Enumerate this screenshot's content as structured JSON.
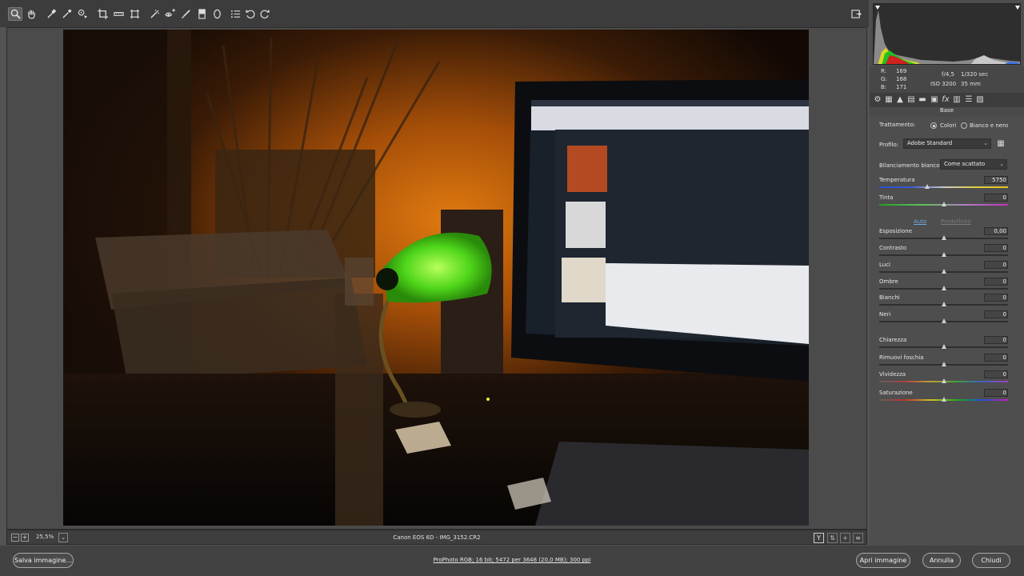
{
  "colors": {
    "accent_blue": "#6fa8dc",
    "panel": "#4e4e4e",
    "toolbar": "#3c3c3c"
  },
  "toolbar": {
    "tools": [
      "zoom-icon",
      "hand-icon",
      "white-balance-icon",
      "color-sampler-icon",
      "target-adjust-icon",
      "crop-icon",
      "straighten-icon",
      "transform-icon",
      "spot-removal-icon",
      "red-eye-icon",
      "adjustment-brush-icon",
      "graduated-filter-icon",
      "radial-filter-icon",
      "preferences-icon",
      "rotate-left-icon",
      "rotate-right-icon"
    ]
  },
  "readout": {
    "r_label": "R:",
    "r_value": "169",
    "g_label": "G:",
    "g_value": "168",
    "b_label": "B:",
    "b_value": "171",
    "aperture": "f/4,5",
    "shutter": "1/320 sec",
    "iso": "ISO 3200",
    "focal": "35 mm"
  },
  "panel": {
    "section_title": "Base",
    "treatment_label": "Trattamento:",
    "treatment_color": "Colori",
    "treatment_bw": "Bianco e nero",
    "profile_label": "Profilo:",
    "profile_value": "Adobe Standard",
    "wb_label": "Bilanciamento bianco:",
    "wb_value": "Come scattato",
    "auto_label": "Auto",
    "default_label": "Predefinito",
    "sliders": [
      {
        "label": "Temperatura",
        "value": "5750",
        "pos": 0.37
      },
      {
        "label": "Tinta",
        "value": "0",
        "pos": 0.5
      },
      {
        "label": "Esposizione",
        "value": "0,00",
        "pos": 0.5
      },
      {
        "label": "Contrasto",
        "value": "0",
        "pos": 0.5
      },
      {
        "label": "Luci",
        "value": "0",
        "pos": 0.5
      },
      {
        "label": "Ombre",
        "value": "0",
        "pos": 0.5
      },
      {
        "label": "Bianchi",
        "value": "0",
        "pos": 0.5
      },
      {
        "label": "Neri",
        "value": "0",
        "pos": 0.5
      },
      {
        "label": "Chiarezza",
        "value": "0",
        "pos": 0.5
      },
      {
        "label": "Rimuovi foschia",
        "value": "0",
        "pos": 0.5
      },
      {
        "label": "Vividezza",
        "value": "0",
        "pos": 0.5
      },
      {
        "label": "Saturazione",
        "value": "0",
        "pos": 0.5
      }
    ]
  },
  "status": {
    "zoom": "25,5%",
    "filename": "Canon EOS 6D  -  IMG_3152.CR2"
  },
  "bottom": {
    "save_label": "Salva immagine...",
    "workflow": "ProPhoto RGB; 16 bit; 5472 per 3648 (20,0 MB); 300 ppi",
    "open_label": "Apri immagine",
    "cancel_label": "Annulla",
    "close_label": "Chiudi"
  }
}
